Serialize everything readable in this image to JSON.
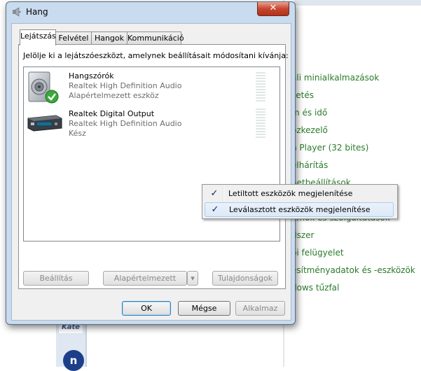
{
  "background": {
    "links": [
      "ali minialkalmazások",
      "zetés",
      "m és idő",
      "özkezelő",
      "n Player (32 bites)",
      "elhárítás",
      "netbeállítások",
      "amok és szolgáltatások",
      "dszer",
      "ői felügyelet",
      "esítményadatok és -eszközök",
      "dows tűzfal"
    ],
    "strip_text_top": "Kate",
    "strip_text_bottom": "n"
  },
  "dialog": {
    "title": "Hang",
    "close_glyph": "✕",
    "tabs": [
      "Lejátszás",
      "Felvétel",
      "Hangok",
      "Kommunikáció"
    ],
    "active_tab": "Lejátszás",
    "instruction": "Jelölje ki a lejátszóeszközt, amelynek beállításait módosítani kívánja:",
    "devices": [
      {
        "name": "Hangszórók",
        "description": "Realtek High Definition Audio",
        "status": "Alapértelmezett eszköz",
        "icon": "speaker-icon",
        "is_default": true
      },
      {
        "name": "Realtek Digital Output",
        "description": "Realtek High Definition Audio",
        "status": "Kész",
        "icon": "digital-output-icon",
        "is_default": false
      }
    ],
    "buttons": {
      "configure": "Beállítás",
      "set_default": "Alapértelmezett",
      "set_default_arrow": "▾",
      "properties": "Tulajdonságok",
      "ok": "OK",
      "cancel": "Mégse",
      "apply": "Alkalmaz"
    }
  },
  "context_menu": {
    "items": [
      {
        "label": "Letiltott eszközök megjelenítése",
        "checked": true,
        "check_glyph": "✓"
      },
      {
        "label": "Leválasztott eszközök megjelenítése",
        "checked": true,
        "check_glyph": "✓"
      }
    ]
  },
  "colors": {
    "link_green": "#2a7a2a",
    "close_red": "#c8452e",
    "frame_blue": "#c9dbee"
  }
}
